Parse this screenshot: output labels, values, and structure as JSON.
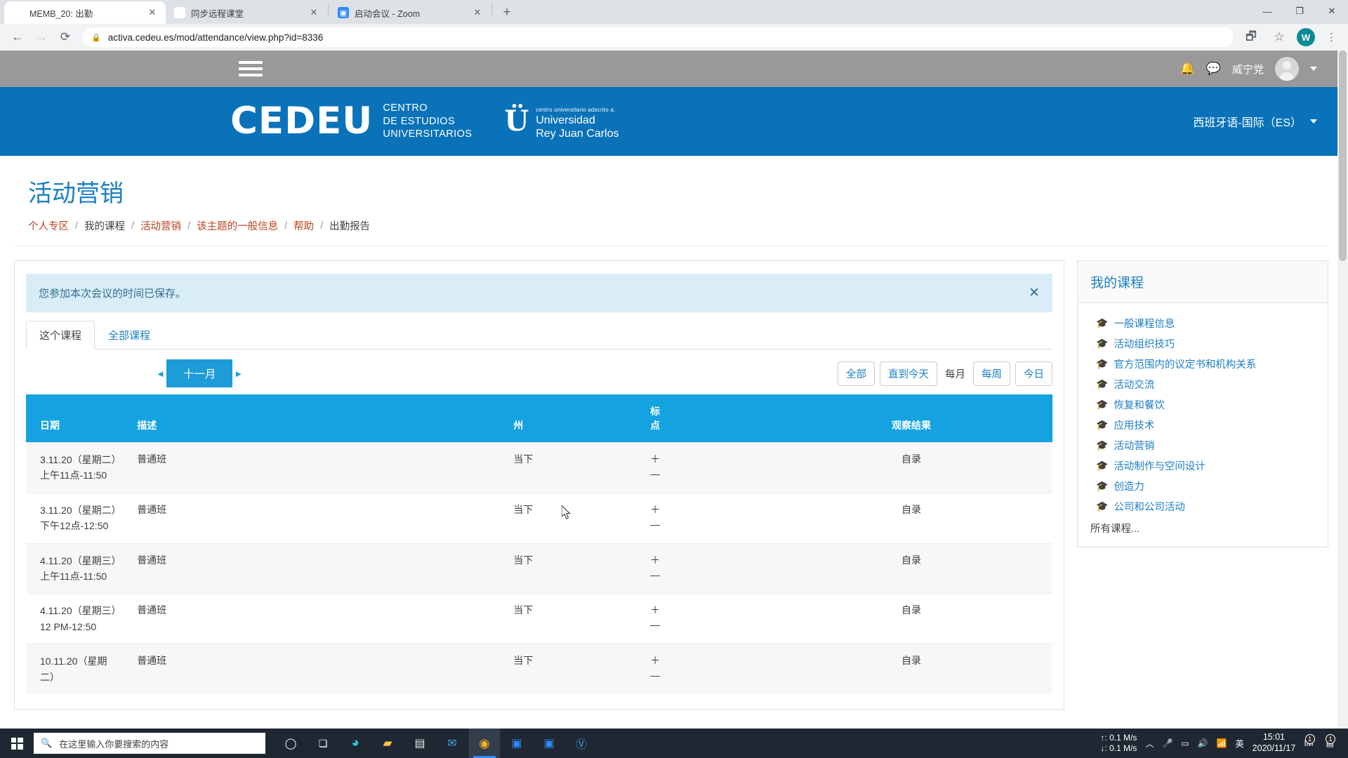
{
  "browser": {
    "tabs": [
      {
        "title": "MEMB_20: 出勤",
        "favicon": "cedeu-c-icon",
        "active": true
      },
      {
        "title": "同步远程课堂",
        "favicon": "cedeu-c-icon",
        "active": false
      },
      {
        "title": "启动会议 - Zoom",
        "favicon": "zoom-icon",
        "active": false
      }
    ],
    "new_tab_label": "+",
    "window_controls": {
      "minimize": "—",
      "maximize": "❐",
      "close": "✕"
    },
    "nav": {
      "back": "←",
      "forward": "→",
      "reload": "⟳"
    },
    "url": "activa.cedeu.es/mod/attendance/view.php?id=8336",
    "profile_initial": "W",
    "kebab": "⋮"
  },
  "topnav": {
    "user_name": "威宁党",
    "notification_icon": "bell-icon",
    "message_icon": "chat-icon"
  },
  "brand": {
    "logo_text": "CEDEU",
    "logo_sub_lines": [
      "CENTRO",
      "DE ESTUDIOS",
      "UNIVERSITARIOS"
    ],
    "partner_small": "centro universitario adscrito a:",
    "partner_lines": [
      "Universidad",
      "Rey Juan Carlos"
    ],
    "partner_mark": "Ü",
    "language": "西班牙语-国际（ES）"
  },
  "page": {
    "title": "活动营销",
    "breadcrumb": [
      {
        "label": "个人专区",
        "link": true
      },
      {
        "label": "我的课程",
        "link": false
      },
      {
        "label": "活动营销",
        "link": true
      },
      {
        "label": "该主题的一般信息",
        "link": true
      },
      {
        "label": "帮助",
        "link": true
      },
      {
        "label": "出勤报告",
        "link": false
      }
    ],
    "separator": "/"
  },
  "alert": {
    "message": "您参加本次会议的时间已保存。",
    "close": "✕"
  },
  "tabs": [
    {
      "label": "这个课程",
      "active": true
    },
    {
      "label": "全部课程",
      "active": false
    }
  ],
  "toolbar": {
    "prev_arrow": "◄",
    "next_arrow": "►",
    "month": "十一月",
    "filters": [
      {
        "label": "全部",
        "style": "outline"
      },
      {
        "label": "直到今天",
        "style": "outline"
      },
      {
        "label": "每月",
        "style": "plain"
      },
      {
        "label": "每周",
        "style": "outline"
      },
      {
        "label": "今日",
        "style": "outline"
      }
    ]
  },
  "table": {
    "headers": {
      "date": "日期",
      "description": "描述",
      "state": "州",
      "points": "标\n点",
      "points_l1": "标",
      "points_l2": "点",
      "remarks": "观察结果"
    },
    "rows": [
      {
        "date": "3.11.20（星期二）上午11点-11:50",
        "description": "普通班",
        "state": "当下",
        "points_plus": "＋",
        "points_minus": "—",
        "remarks": "自录"
      },
      {
        "date": "3.11.20（星期二）下午12点-12:50",
        "description": "普通班",
        "state": "当下",
        "points_plus": "＋",
        "points_minus": "—",
        "remarks": "自录"
      },
      {
        "date": "4.11.20（星期三）上午11点-11:50",
        "description": "普通班",
        "state": "当下",
        "points_plus": "＋",
        "points_minus": "—",
        "remarks": "自录"
      },
      {
        "date": "4.11.20（星期三）12 PM-12:50",
        "description": "普通班",
        "state": "当下",
        "points_plus": "＋",
        "points_minus": "—",
        "remarks": "自录"
      },
      {
        "date": "10.11.20（星期二）",
        "description": "普通班",
        "state": "当下",
        "points_plus": "＋",
        "points_minus": "—",
        "remarks": "自录"
      }
    ]
  },
  "sidebar": {
    "title": "我的课程",
    "icon": "graduation-cap-icon",
    "courses": [
      "一般课程信息",
      "活动组织技巧",
      "官方范围内的议定书和机构关系",
      "活动交流",
      "恢复和餐饮",
      "应用技术",
      "活动营销",
      "活动制作与空间设计",
      "创造力",
      "公司和公司活动"
    ],
    "all_courses": "所有课程..."
  },
  "taskbar": {
    "search_placeholder": "在这里输入你要搜索的内容",
    "apps": [
      {
        "name": "cortana-icon",
        "glyph": "O"
      },
      {
        "name": "task-view-icon",
        "glyph": "❑"
      },
      {
        "name": "edge-icon",
        "glyph": "e"
      },
      {
        "name": "file-explorer-icon",
        "glyph": "📁"
      },
      {
        "name": "microsoft-store-icon",
        "glyph": "🛍"
      },
      {
        "name": "mail-icon",
        "glyph": "✉"
      },
      {
        "name": "chrome-icon",
        "glyph": "◉"
      },
      {
        "name": "video-app-icon",
        "glyph": "▣"
      },
      {
        "name": "zoom-icon",
        "glyph": "▢"
      },
      {
        "name": "v-app-icon",
        "glyph": "V"
      }
    ],
    "network_up": "↑: 0.1 M/s",
    "network_down": "↓: 0.1 M/s",
    "ime": "英",
    "time": "15:01",
    "date": "2020/11/17",
    "tray_badge_1": "1",
    "tray_badge_2": "1"
  },
  "colors": {
    "brand_blue": "#0a72b9",
    "table_header_blue": "#14a2e0",
    "accent_blue": "#1d7fc3",
    "alert_bg": "#d9edf7",
    "breadcrumb_link": "#b8431f"
  }
}
